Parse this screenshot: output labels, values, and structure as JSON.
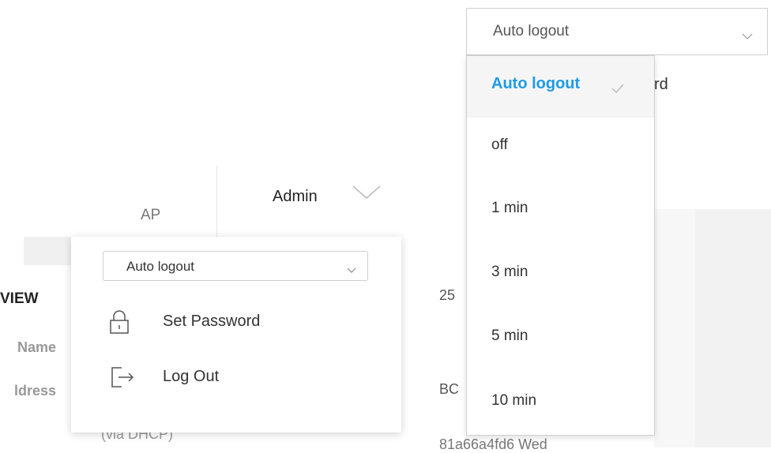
{
  "background": {
    "ap_label": "AP",
    "admin_label": "Admin",
    "overview_label": "VIEW",
    "name_label": "Name",
    "address_label": "ldress",
    "via_dhcp": "(via DHCP)",
    "value_25": "25",
    "value_bc": "BC",
    "value_mac": "81a66a4fd6 Wed",
    "partial_word": "rd"
  },
  "admin_menu": {
    "auto_logout_select": {
      "value": "Auto logout"
    },
    "items": [
      {
        "label": "Set Password",
        "icon": "lock-icon"
      },
      {
        "label": "Log Out",
        "icon": "logout-icon"
      }
    ]
  },
  "auto_logout_dropdown": {
    "selected": "Auto logout",
    "options": [
      {
        "label": "Auto logout",
        "selected": true
      },
      {
        "label": "off",
        "selected": false
      },
      {
        "label": "1 min",
        "selected": false
      },
      {
        "label": "3 min",
        "selected": false
      },
      {
        "label": "5 min",
        "selected": false
      },
      {
        "label": "10 min",
        "selected": false
      }
    ]
  },
  "colors": {
    "accent": "#1e9be6",
    "border": "#cfcfcf",
    "text": "#333333",
    "muted": "#999999"
  }
}
